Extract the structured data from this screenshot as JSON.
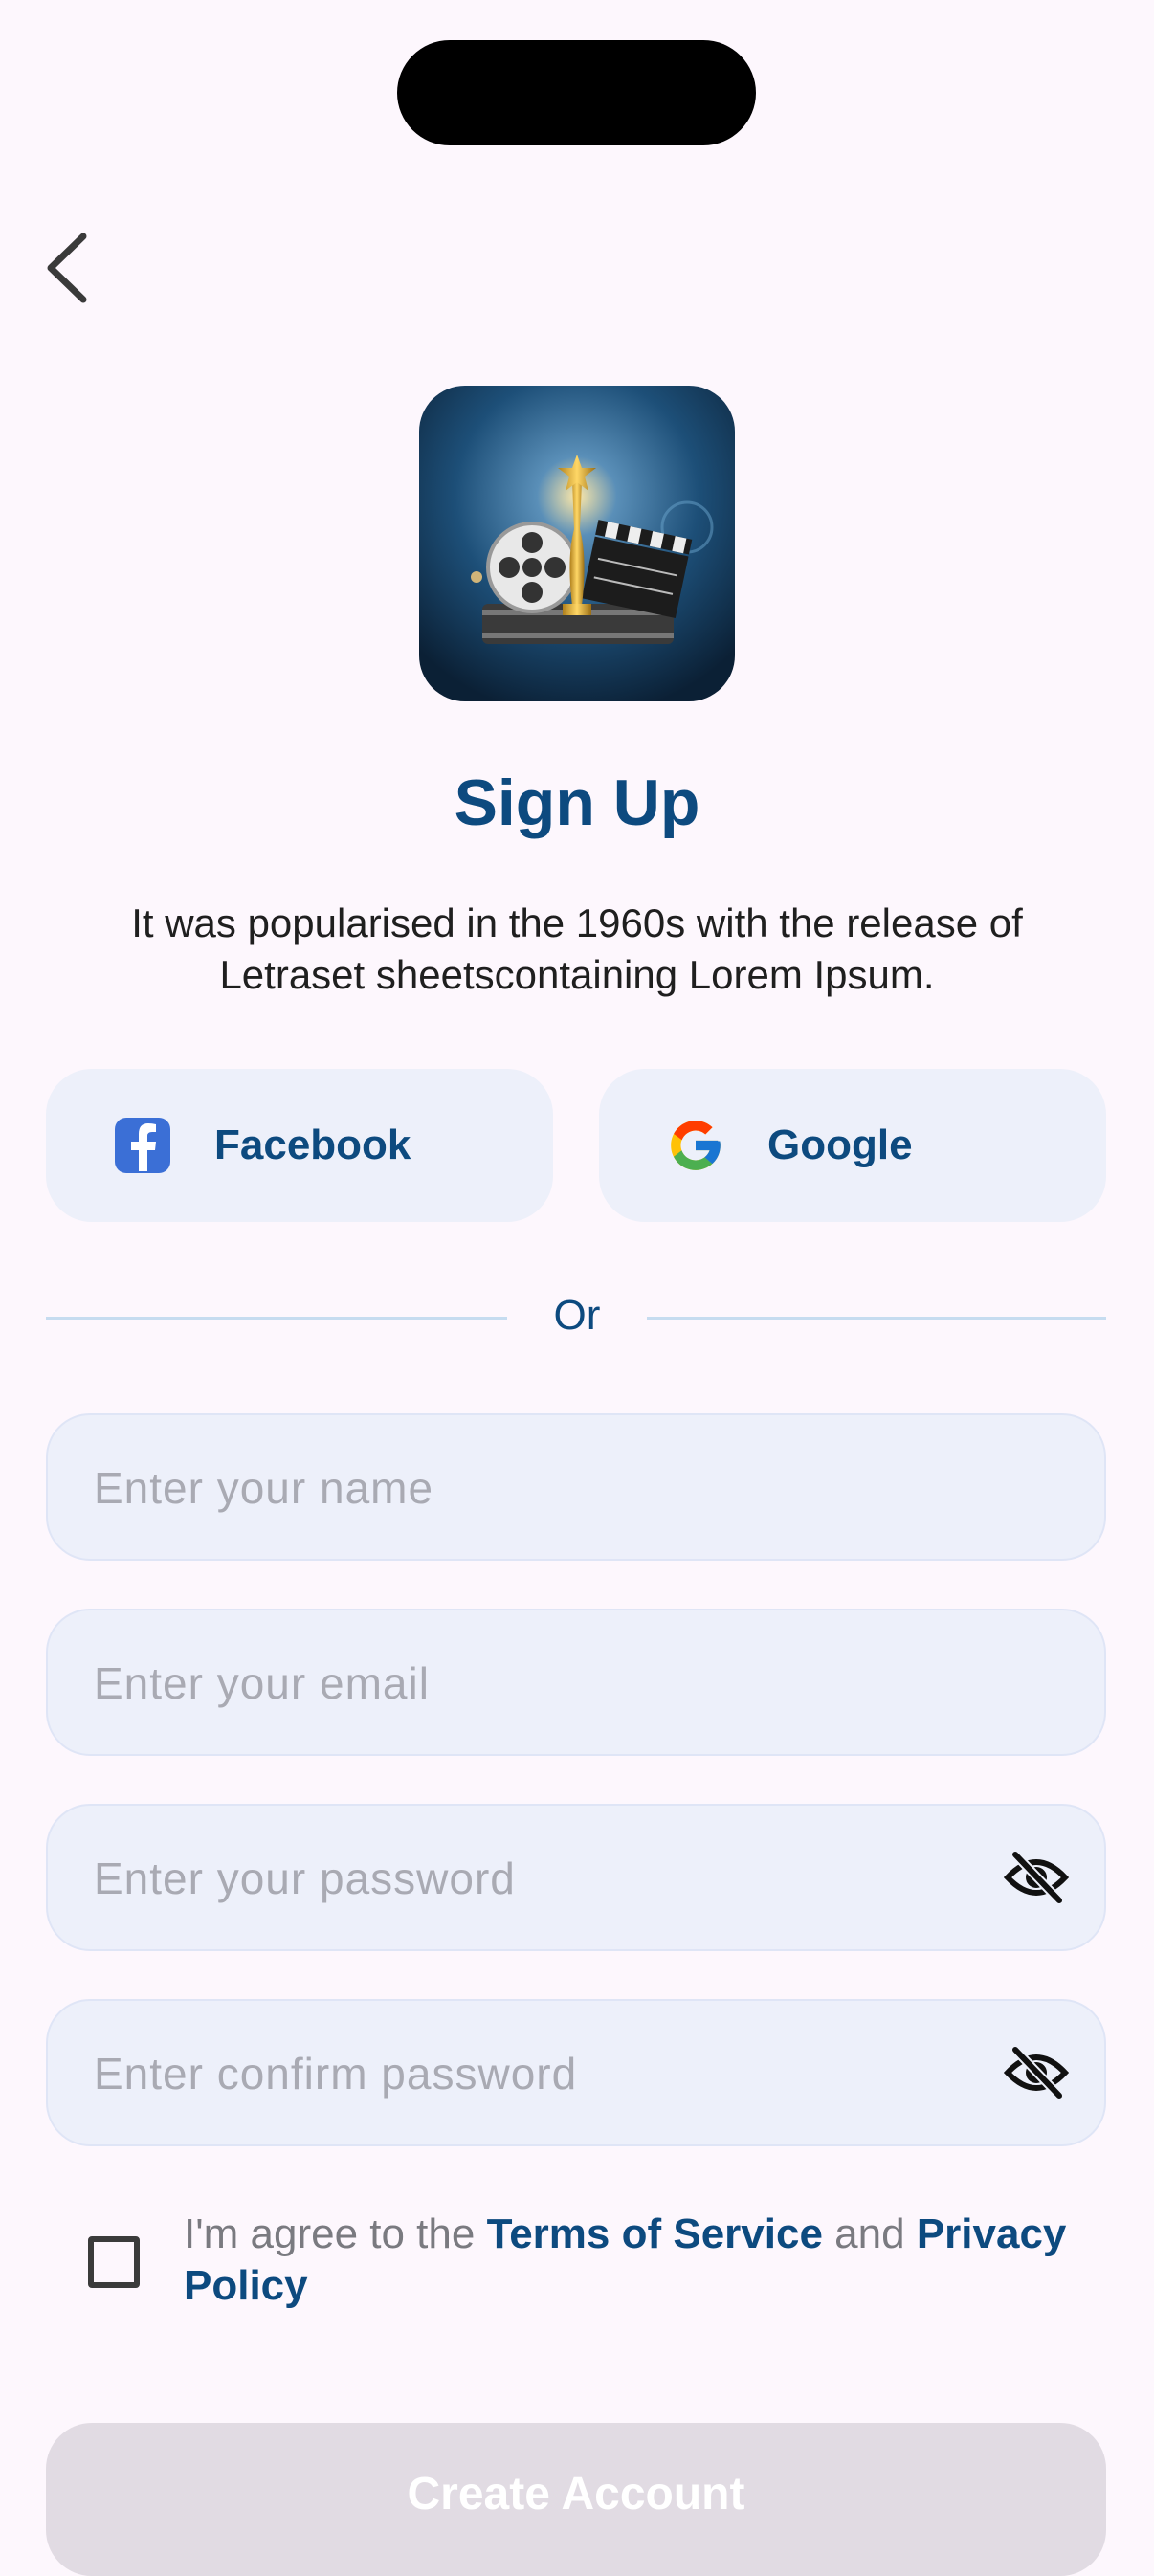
{
  "header": {
    "back_icon": "chevron-left-icon"
  },
  "logo": {
    "icon": "cinema-logo-icon"
  },
  "title": "Sign Up",
  "subtitle": "It was popularised in the 1960s with the release of Letraset sheetscontaining Lorem Ipsum.",
  "social": {
    "facebook": {
      "label": "Facebook",
      "icon": "facebook-icon",
      "color": "#3b6fd6"
    },
    "google": {
      "label": "Google",
      "icon": "google-icon"
    }
  },
  "divider": {
    "label": "Or"
  },
  "form": {
    "name": {
      "placeholder": "Enter your name",
      "value": ""
    },
    "email": {
      "placeholder": "Enter your email",
      "value": ""
    },
    "password": {
      "placeholder": "Enter your password",
      "value": "",
      "toggle_icon": "eye-off-icon"
    },
    "confirm_password": {
      "placeholder": "Enter confirm password",
      "value": "",
      "toggle_icon": "eye-off-icon"
    }
  },
  "agreement": {
    "checked": false,
    "prefix": "I'm agree to the ",
    "terms_link": "Terms of Service",
    "middle": " and ",
    "privacy_link": "Privacy Policy"
  },
  "submit": {
    "label": "Create Account"
  },
  "colors": {
    "primary": "#0d4a7f",
    "background": "#fdf7fd",
    "field_bg": "#edf0fa",
    "button_disabled": "#e1dbe3"
  }
}
